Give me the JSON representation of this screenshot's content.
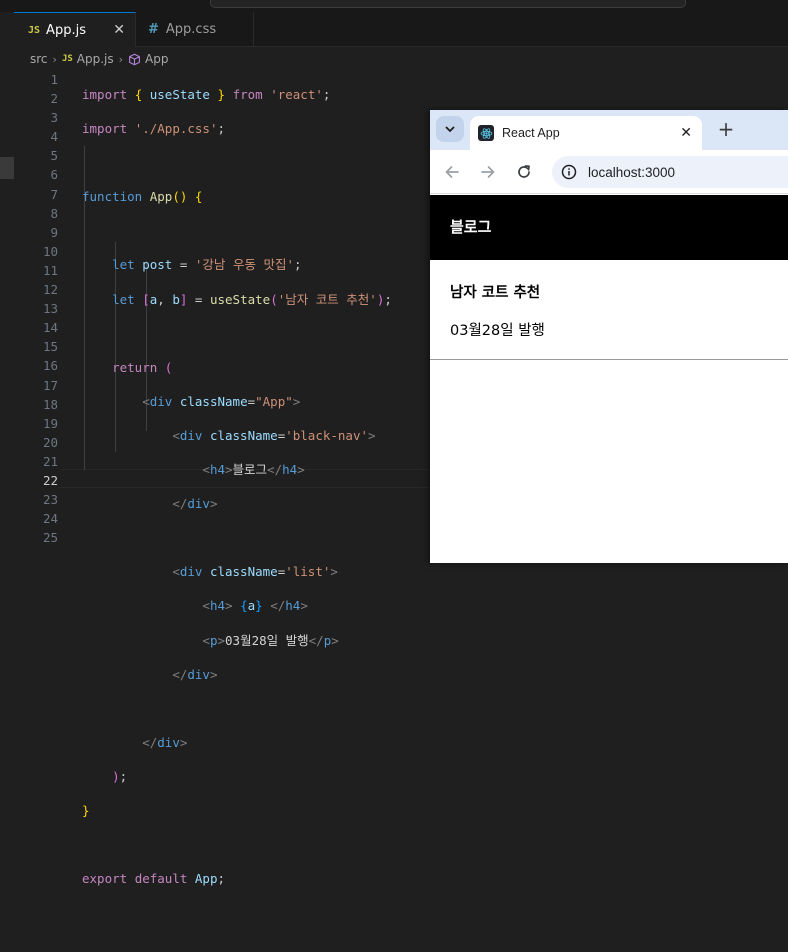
{
  "editor": {
    "tabs": [
      {
        "badge": "JS",
        "label": "App.js",
        "active": true,
        "close": "✕"
      },
      {
        "badge": "#",
        "label": "App.css",
        "active": false
      }
    ],
    "breadcrumb": {
      "folder": "src",
      "file_badge": "JS",
      "file": "App.js",
      "symbol": "App"
    },
    "current_line": "22"
  },
  "browser": {
    "tab_title": "React App",
    "tab_close": "✕",
    "new_tab": "+",
    "url": "localhost:3000",
    "page": {
      "nav_title": "블로그",
      "post_title": "남자 코트 추천",
      "post_date": "03월28일 발행"
    }
  },
  "icons": {
    "tab_search": "chevron-down-icon",
    "back": "arrow-left-icon",
    "forward": "arrow-right-icon",
    "reload": "reload-icon",
    "site_info": "info-icon",
    "favicon": "react-logo-icon",
    "symbol": "cube-icon"
  },
  "colors": {
    "keyword": "#569cd6",
    "control_keyword": "#c586c0",
    "string": "#ce9178",
    "function": "#dcdcaa",
    "variable": "#9cdcfe",
    "editor_bg": "#1f1f1f",
    "nav_bg": "#000000"
  }
}
